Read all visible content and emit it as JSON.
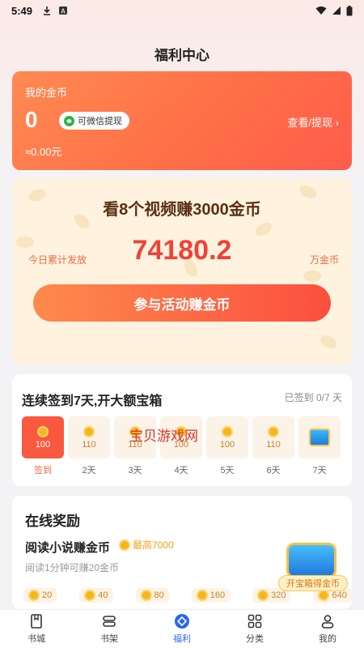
{
  "status": {
    "time": "5:49"
  },
  "header": {
    "title": "福利中心"
  },
  "coins": {
    "label": "我的金币",
    "amount": "0",
    "wechat_badge": "可微信提现",
    "view_link": "查看/提现",
    "yuan": "≈0.00元"
  },
  "video": {
    "title": "看8个视频赚3000金币",
    "today_label": "今日累计发放",
    "total": "74180.2",
    "unit": "万金币",
    "button": "参与活动赚金币"
  },
  "signin": {
    "title": "连续签到7天,开大额宝箱",
    "status": "已签到 0/7 天",
    "days": [
      {
        "value": "100",
        "label": "签到"
      },
      {
        "value": "110",
        "label": "2天"
      },
      {
        "value": "110",
        "label": "3天"
      },
      {
        "value": "100",
        "label": "4天"
      },
      {
        "value": "100",
        "label": "5天"
      },
      {
        "value": "110",
        "label": "6天"
      },
      {
        "value": "",
        "label": "7天"
      }
    ]
  },
  "watermark": "宝贝游戏网",
  "online": {
    "title": "在线奖励",
    "read_title": "阅读小说赚金币",
    "max": "最高7000",
    "sub": "阅读1分钟可赚20金币",
    "rewards": [
      "20",
      "40",
      "80",
      "160",
      "320",
      "640"
    ],
    "chest_label": "开宝箱得金币"
  },
  "tabs": [
    {
      "label": "书城",
      "icon": "book-icon"
    },
    {
      "label": "书架",
      "icon": "shelf-icon"
    },
    {
      "label": "福利",
      "icon": "gift-icon"
    },
    {
      "label": "分类",
      "icon": "grid-icon"
    },
    {
      "label": "我的",
      "icon": "user-icon"
    }
  ],
  "colors": {
    "accent": "#ff6f47",
    "active_tab": "#2a66f0",
    "number": "#f2403a"
  }
}
